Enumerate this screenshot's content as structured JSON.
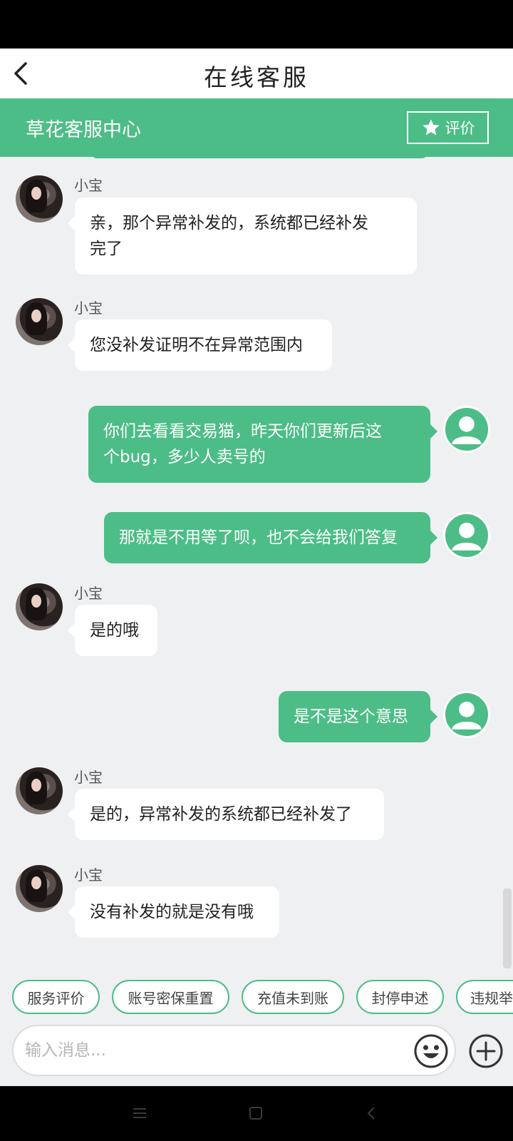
{
  "header": {
    "title": "在线客服"
  },
  "service_bar": {
    "name": "草花客服中心",
    "rate_label": "评价"
  },
  "messages": [
    {
      "side": "in",
      "sender": "小宝",
      "lines": [
        "亲，那个异常补发的，系统都已经补发",
        "完了"
      ]
    },
    {
      "side": "in",
      "sender": "小宝",
      "lines": [
        "您没补发证明不在异常范围内"
      ]
    },
    {
      "side": "out",
      "lines": [
        "你们去看看交易猫，昨天你们更新后这",
        "个bug，多少人卖号的"
      ]
    },
    {
      "side": "out",
      "lines": [
        "那就是不用等了呗，也不会给我们答复"
      ]
    },
    {
      "side": "in",
      "sender": "小宝",
      "lines": [
        "是的哦"
      ]
    },
    {
      "side": "out",
      "lines": [
        "是不是这个意思"
      ]
    },
    {
      "side": "in",
      "sender": "小宝",
      "lines": [
        "是的，异常补发的系统都已经补发了"
      ]
    },
    {
      "side": "in",
      "sender": "小宝",
      "lines": [
        "没有补发的就是没有哦"
      ]
    }
  ],
  "quick_replies": [
    "服务评价",
    "账号密保重置",
    "充值未到账",
    "封停申述",
    "违规举报"
  ],
  "input": {
    "placeholder": "输入消息..."
  },
  "colors": {
    "accent": "#4cbd86",
    "chat_bg": "#eff0f2"
  },
  "icons": {
    "back": "chevron-left-icon",
    "rate": "star-icon",
    "emoji": "smiley-icon",
    "plus": "plus-circle-icon",
    "user_avatar": "person-icon"
  }
}
